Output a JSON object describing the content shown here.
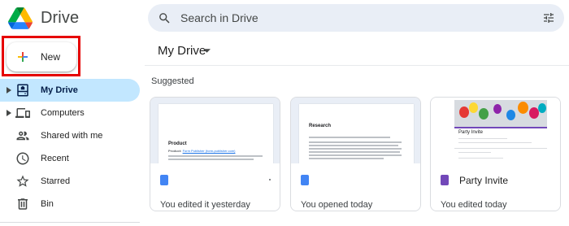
{
  "app": {
    "name": "Drive"
  },
  "search": {
    "placeholder": "Search in Drive"
  },
  "sidebar": {
    "new_label": "New",
    "items": [
      {
        "label": "My Drive",
        "icon": "my-drive-icon",
        "active": true,
        "expandable": true
      },
      {
        "label": "Computers",
        "icon": "computers-icon",
        "active": false,
        "expandable": true
      },
      {
        "label": "Shared with me",
        "icon": "shared-icon",
        "active": false,
        "expandable": false
      },
      {
        "label": "Recent",
        "icon": "clock-icon",
        "active": false,
        "expandable": false
      },
      {
        "label": "Starred",
        "icon": "star-icon",
        "active": false,
        "expandable": false
      },
      {
        "label": "Bin",
        "icon": "trash-icon",
        "active": false,
        "expandable": false
      }
    ]
  },
  "main": {
    "title": "My Drive",
    "section_label": "Suggested",
    "cards": [
      {
        "name": "",
        "meta": "You edited it yesterday",
        "file_type": "docs",
        "preview_title": "Product",
        "preview_subtitle": "Product: ",
        "preview_link": "Form Publisher (form-publisher.com)"
      },
      {
        "name": "",
        "meta": "You opened today",
        "file_type": "docs",
        "preview_title": "Research"
      },
      {
        "name": "Party Invite",
        "meta": "You edited today",
        "file_type": "forms",
        "preview_title": "Party Invite"
      }
    ]
  },
  "colors": {
    "accent": "#c2e7ff",
    "highlight_box": "#e60000",
    "docs_blue": "#4285f4",
    "forms_purple": "#7248b9"
  }
}
